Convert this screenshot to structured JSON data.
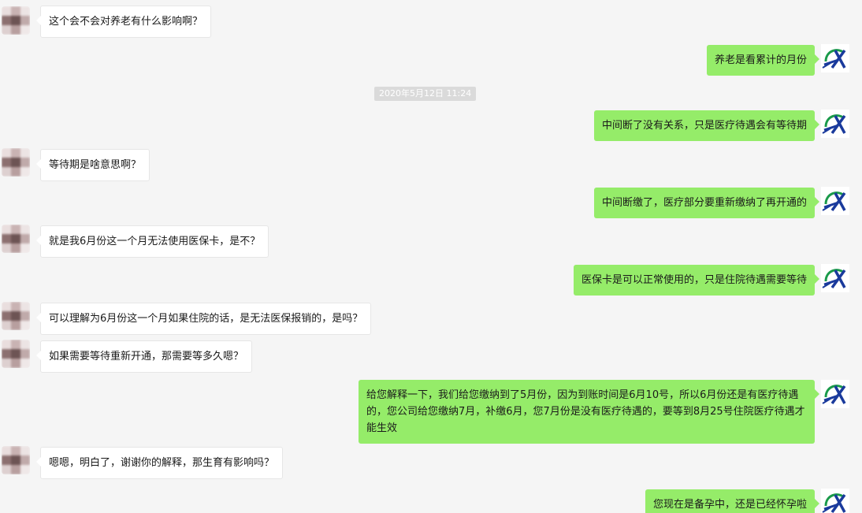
{
  "timestamp": "2020年5月12日 11:24",
  "colors": {
    "background": "#f5f5f5",
    "self_bubble": "#95ec69",
    "other_bubble": "#ffffff",
    "logo_blue": "#1a3a9c",
    "logo_green": "#1a9a4a"
  },
  "messages": [
    {
      "sender": "other",
      "text": "这个会不会对养老有什么影响啊？"
    },
    {
      "sender": "self",
      "text": "养老是看累计的月份"
    },
    {
      "sender": "self",
      "text": "中间断了没有关系，只是医疗待遇会有等待期"
    },
    {
      "sender": "other",
      "text": "等待期是啥意思啊？"
    },
    {
      "sender": "self",
      "text": "中间断缴了，医疗部分要重新缴纳了再开通的"
    },
    {
      "sender": "other",
      "text": "就是我6月份这一个月无法使用医保卡，是不？"
    },
    {
      "sender": "self",
      "text": "医保卡是可以正常使用的，只是住院待遇需要等待"
    },
    {
      "sender": "other",
      "text": "可以理解为6月份这一个月如果住院的话，是无法医保报销的，是吗？"
    },
    {
      "sender": "other",
      "text": "如果需要等待重新开通，那需要等多久嗯？"
    },
    {
      "sender": "self",
      "text": "给您解释一下，我们给您缴纳到了5月份，因为到账时间是6月10号，所以6月份还是有医疗待遇的，您公司给您缴纳7月，补缴6月，您7月份是没有医疗待遇的，要等到8月25号住院医疗待遇才能生效"
    },
    {
      "sender": "other",
      "text": "嗯嗯，明白了，谢谢你的解释，那生育有影响吗？"
    },
    {
      "sender": "self",
      "text": "您现在是备孕中，还是已经怀孕啦"
    }
  ]
}
